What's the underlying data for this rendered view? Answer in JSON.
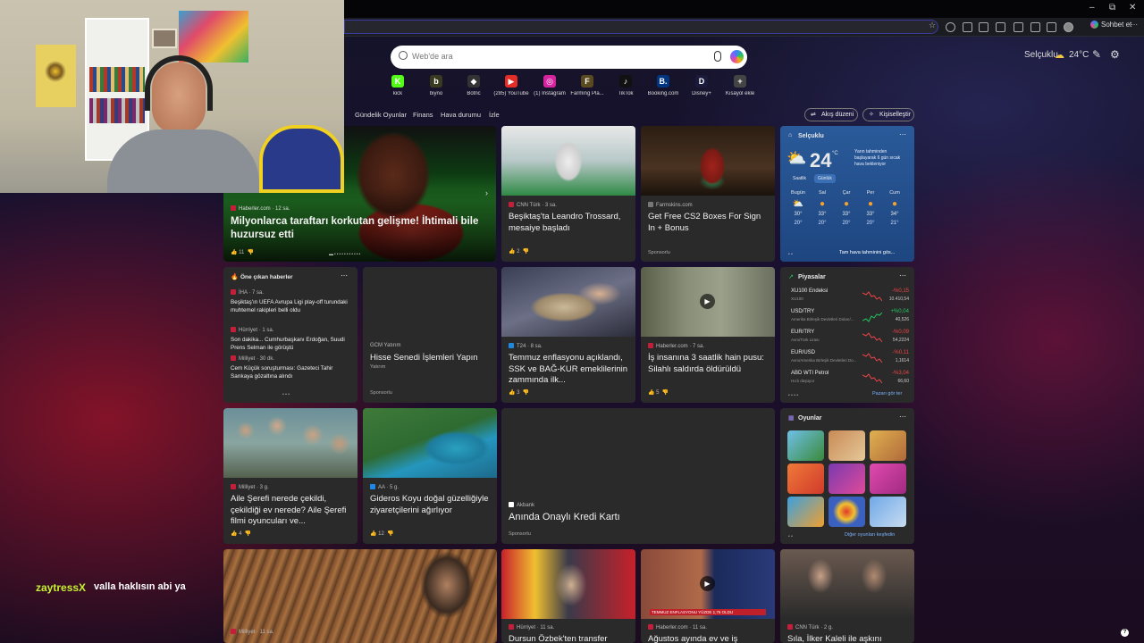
{
  "browser": {
    "chat_label": "Sohbet et",
    "win_min": "–",
    "win_max": "⧉",
    "win_close": "✕"
  },
  "topbar": {
    "location": "Selçuklu",
    "temp": "24°C"
  },
  "search": {
    "placeholder": "Web'de ara"
  },
  "shortcuts": [
    {
      "label": "kick",
      "icon": "K",
      "color": "#53fc18"
    },
    {
      "label": "biyno",
      "icon": "b",
      "color": "#3a3a20"
    },
    {
      "label": "Botric",
      "icon": "◆",
      "color": "#333333"
    },
    {
      "label": "(285) YouTube",
      "icon": "▶",
      "color": "#e52d27"
    },
    {
      "label": "(1) Instagram",
      "icon": "◎",
      "color": "#d6249f"
    },
    {
      "label": "Farming Pla...",
      "icon": "F",
      "color": "#5a4a20"
    },
    {
      "label": "TikTok",
      "icon": "♪",
      "color": "#111111"
    },
    {
      "label": "Booking.com",
      "icon": "B.",
      "color": "#003580"
    },
    {
      "label": "Disney+",
      "icon": "D",
      "color": "#1a1a3a"
    },
    {
      "label": "Kısayol ekle",
      "icon": "+",
      "color": "#444444"
    }
  ],
  "nav": {
    "items": [
      "Gündelik Oyunlar",
      "Finans",
      "Hava durumu",
      "İzle"
    ],
    "feed_settings": "Akış düzeni",
    "personalize": "Kişiselleştir"
  },
  "hero": {
    "source": "Haberler.com · 12 sa.",
    "title": "Milyonlarca taraftarı korkutan gelişme! İhtimali bile huzursuz etti",
    "likes": "11"
  },
  "card2": {
    "source": "CNN Türk · 3 sa.",
    "title": "Beşiktaş'ta Leandro Trossard, mesaiye başladı",
    "likes": "2"
  },
  "card3": {
    "source": "Farmskins.com",
    "title": "Get Free CS2 Boxes For Sign In + Bonus",
    "sponsored": "Sponsorlu"
  },
  "weather": {
    "location": "Selçuklu",
    "temp": "24",
    "unit": "°C",
    "note": "Yarın tahminden başlayarak 6 gün sıcak hava bekleniyor",
    "tab_hourly": "Saatlik",
    "tab_daily": "Günlük",
    "days": [
      {
        "name": "Bugün",
        "hi": "30°",
        "lo": "20°"
      },
      {
        "name": "Sal",
        "hi": "33°",
        "lo": "20°"
      },
      {
        "name": "Çar",
        "hi": "33°",
        "lo": "20°"
      },
      {
        "name": "Per",
        "hi": "33°",
        "lo": "20°"
      },
      {
        "name": "Cum",
        "hi": "34°",
        "lo": "21°"
      }
    ],
    "link": "Tam hava tahminini gös..."
  },
  "top_news": {
    "header": "Öne çıkan haberler",
    "items": [
      {
        "source": "İHA · 7 sa.",
        "title": "Beşiktaş'ın UEFA Avrupa Ligi play-off turundaki muhtemel rakipleri belli oldu"
      },
      {
        "source": "Hürriyet · 1 sa.",
        "title": "Son dakika... Cumhurbaşkanı Erdoğan, Suudi Prens Selman ile görüştü"
      },
      {
        "source": "Milliyet · 30 dk.",
        "title": "Cem Küçük soruşturması: Gazeteci Tahir Sarıkaya gözaltına alındı"
      }
    ]
  },
  "ad_gcm": {
    "source": "GCM Yatırım",
    "title": "Hisse Senedi İşlemleri Yapın",
    "sub": "Yatırım",
    "sponsored": "Sponsorlu"
  },
  "card_t24": {
    "source": "T24 · 8 sa.",
    "title": "Temmuz enflasyonu açıklandı, SSK ve BAĞ-KUR emeklilerinin zammında ilk...",
    "likes": "3"
  },
  "card_video": {
    "source": "Haberler.com · 7 sa.",
    "title": "İş insanına 3 saatlik hain pusu: Silahlı saldırda öldürüldü",
    "likes": "5"
  },
  "markets": {
    "header": "Piyasalar",
    "rows": [
      {
        "name": "XU100 Endeksi",
        "sub": "XU100",
        "chg": "-%0,15",
        "val": "10.410,54",
        "up": false
      },
      {
        "name": "USD/TRY",
        "sub": "Amerika Birleşik Devletleri Doları/...",
        "chg": "+%0,04",
        "val": "40,526",
        "up": true
      },
      {
        "name": "EUR/TRY",
        "sub": "Avro/Türk Lirası",
        "chg": "-%0,09",
        "val": "54,2224",
        "up": false
      },
      {
        "name": "EUR/USD",
        "sub": "Avro/Amerika Birleşik Devletleri Do...",
        "chg": "-%0,11",
        "val": "1,1614",
        "up": false
      },
      {
        "name": "ABD WTI Petrol",
        "sub": "Hızlı düşüyor",
        "chg": "-%3,04",
        "val": "66,60",
        "up": false
      }
    ],
    "link": "Pazarı gör ter"
  },
  "card_film": {
    "source": "Milliyet · 3 g.",
    "title": "Aile Şerefi nerede çekildi, çekildiği ev nerede? Aile Şerefi filmi oyuncuları ve...",
    "likes": "4"
  },
  "card_aa": {
    "source": "AA · 5 g.",
    "title": "Gideros Koyu doğal güzelliğiyle ziyaretçilerini ağırlıyor",
    "likes": "12"
  },
  "ad_akbank": {
    "source": "Akbank",
    "title": "Anında Onaylı Kredi Kartı",
    "sponsored": "Sponsorlu"
  },
  "games": {
    "header": "Oyunlar",
    "link": "Diğer oyunları keşfedin"
  },
  "bottom": [
    {
      "source": "Milliyet · 11 sa."
    },
    {
      "source": "Hürriyet · 11 sa.",
      "title": "Dursun Özbek'ten transfer"
    },
    {
      "source": "Haberler.com · 11 sa.",
      "title": "Ağustos ayında ev ve iş",
      "video_caption": "TEMMUZ ENFLASYONU YÜZDE 1,76 OLDU"
    },
    {
      "source": "CNN Türk · 2 g.",
      "title": "Sıla, İlker Kaleli ile aşkını"
    }
  ],
  "chat": {
    "user": "zaytressX",
    "message": "valla haklısın abi ya"
  }
}
